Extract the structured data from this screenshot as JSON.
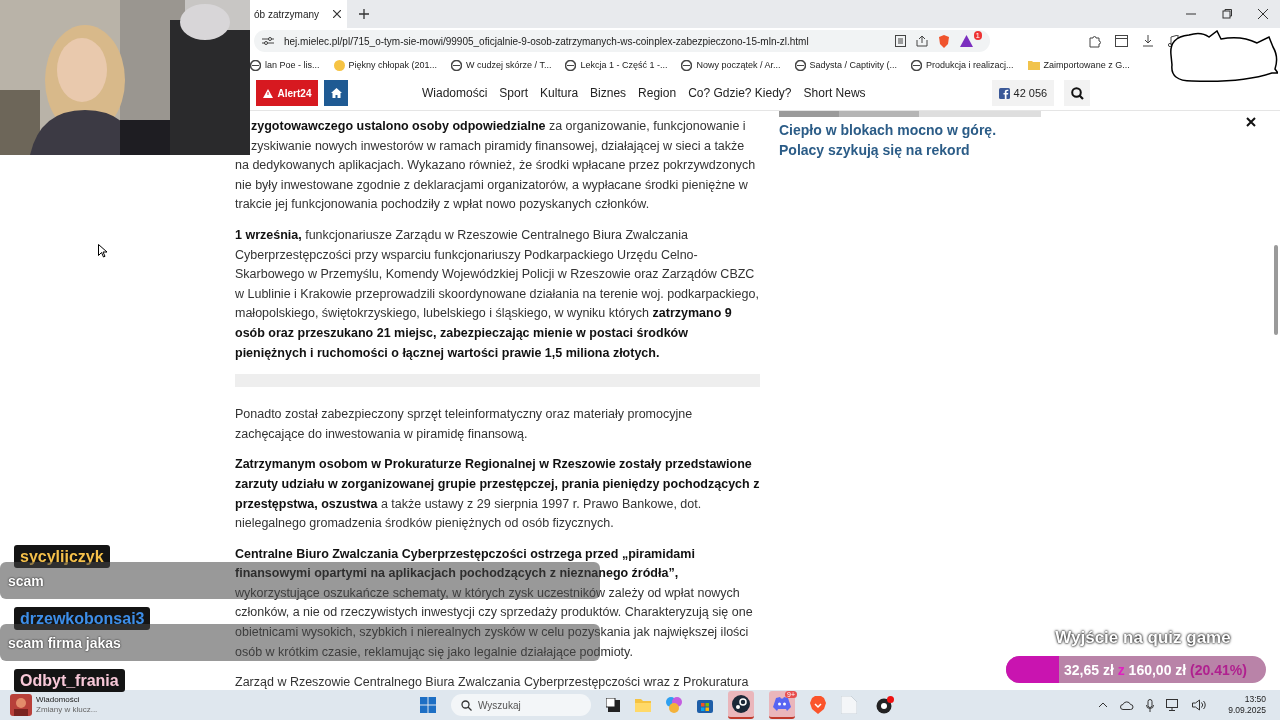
{
  "browser": {
    "tab": {
      "title": "ób zatrzymany",
      "selected": true
    },
    "url": "hej.mielec.pl/pl/715_o-tym-sie-mowi/99905_oficjalnie-9-osob-zatrzymanych-ws-coinplex-zabezpieczono-15-mln-zl.html",
    "extension_badge": "1",
    "bookmarks": [
      {
        "label": "lan Poe - lis...",
        "kind": "page"
      },
      {
        "label": "Piękny chłopak (201...",
        "kind": "emoji"
      },
      {
        "label": "W cudzej skórze / T...",
        "kind": "page"
      },
      {
        "label": "Lekcja 1 - Część 1 -...",
        "kind": "page"
      },
      {
        "label": "Nowy początek / Ar...",
        "kind": "page"
      },
      {
        "label": "Sadysta / Captivity (...",
        "kind": "page"
      },
      {
        "label": "Produkcja i realizacj...",
        "kind": "page"
      },
      {
        "label": "Zaimportowane z G...",
        "kind": "folder"
      }
    ]
  },
  "site_nav": {
    "alert": "Alert24",
    "items": [
      "Wiadomości",
      "Sport",
      "Kultura",
      "Biznes",
      "Region",
      "Co? Gdzie? Kiedy?",
      "Short News"
    ],
    "facebook_count": "42 056"
  },
  "article": {
    "paragraphs": [
      "**zygotowawczego ustalono osoby odpowiedzialne** za organizowanie, funkcjonowanie i zyskiwanie nowych inwestorów w ramach piramidy finansowej, działającej w sieci a także na dedykowanych aplikacjach. Wykazano również, że środki wpłacane przez pokrzywdzonych nie były inwestowane zgodnie z deklaracjami organizatorów, a wypłacane środki pieniężne w trakcie jej funkcjonowania pochodziły z wpłat nowo pozyskanych członków.",
      "**1 września,** funkcjonariusze Zarządu w Rzeszowie Centralnego Biura Zwalczania Cyberprzestępczości przy wsparciu funkcjonariuszy Podkarpackiego Urzędu Celno-Skarbowego w Przemyślu, Komendy Wojewódzkiej Policji w Rzeszowie oraz Zarządów CBZC w Lublinie i Krakowie przeprowadzili skoordynowane działania na terenie woj. podkarpackiego, małopolskiego, świętokrzyskiego, lubelskiego i śląskiego, w wyniku których **zatrzymano 9 osób oraz przeszukano 21 miejsc, zabezpieczając mienie w postaci środków pieniężnych i ruchomości o łącznej wartości prawie 1,5 miliona złotych.**",
      "Ponadto został zabezpieczony sprzęt teleinformatyczny oraz materiały promocyjne zachęcające do inwestowania w piramidę finansową.",
      "**Zatrzymanym osobom w Prokuraturze Regionalnej w Rzeszowie zostały przedstawione zarzuty udziału w zorganizowanej grupie przestępczej, prania pieniędzy pochodzących z przestępstwa, oszustwa** a także ustawy z 29 sierpnia 1997 r. Prawo Bankowe, dot. nielegalnego gromadzenia środków pieniężnych od osób fizycznych.",
      "**Centralne Biuro Zwalczania Cyberprzestępczości ostrzega przed „piramidami finansowymi opartymi na aplikacjach pochodzących z nieznanego źródła”,** wykorzystujące oszukańcze schematy, w których zysk uczestników zależy od wpłat nowych członków, a nie od rzeczywistych inwestycji czy sprzedaży produktów. Charakteryzują się one obietnicami wysokich, szybkich i nierealnych zysków w celu pozyskania jak największej ilości osób w krótkim czasie, reklamując się jako legalnie działające podmioty.",
      "Zarząd w Rzeszowie Centralnego Biura Zwalczania Cyberprzestępczości wraz z Prokuratura"
    ]
  },
  "sidebar": {
    "link": "Ciepło w blokach mocno w górę. Polacy szykują się na rekord"
  },
  "chat": [
    {
      "user": "sycylijczyk",
      "color": "#f5c04a",
      "message": "scam"
    },
    {
      "user": "drzewkobonsai3",
      "color": "#3d8ee8",
      "message": "scam firma jakas"
    },
    {
      "user": "Odbyt_frania",
      "color": "#f8c8d8"
    }
  ],
  "goal": {
    "title": "Wyjście na quiz game",
    "current": "32,65 zł",
    "separator": "z",
    "target": "160,00 zł",
    "percent": "(20.41%)",
    "level": 0.2041
  },
  "taskbar": {
    "news_title": "Wiadomości",
    "news_text": "Zmiany w klucz...",
    "search": "Wyszukaj",
    "discord_badge": "9+",
    "time": "13:50",
    "date": "9.09.2025"
  }
}
